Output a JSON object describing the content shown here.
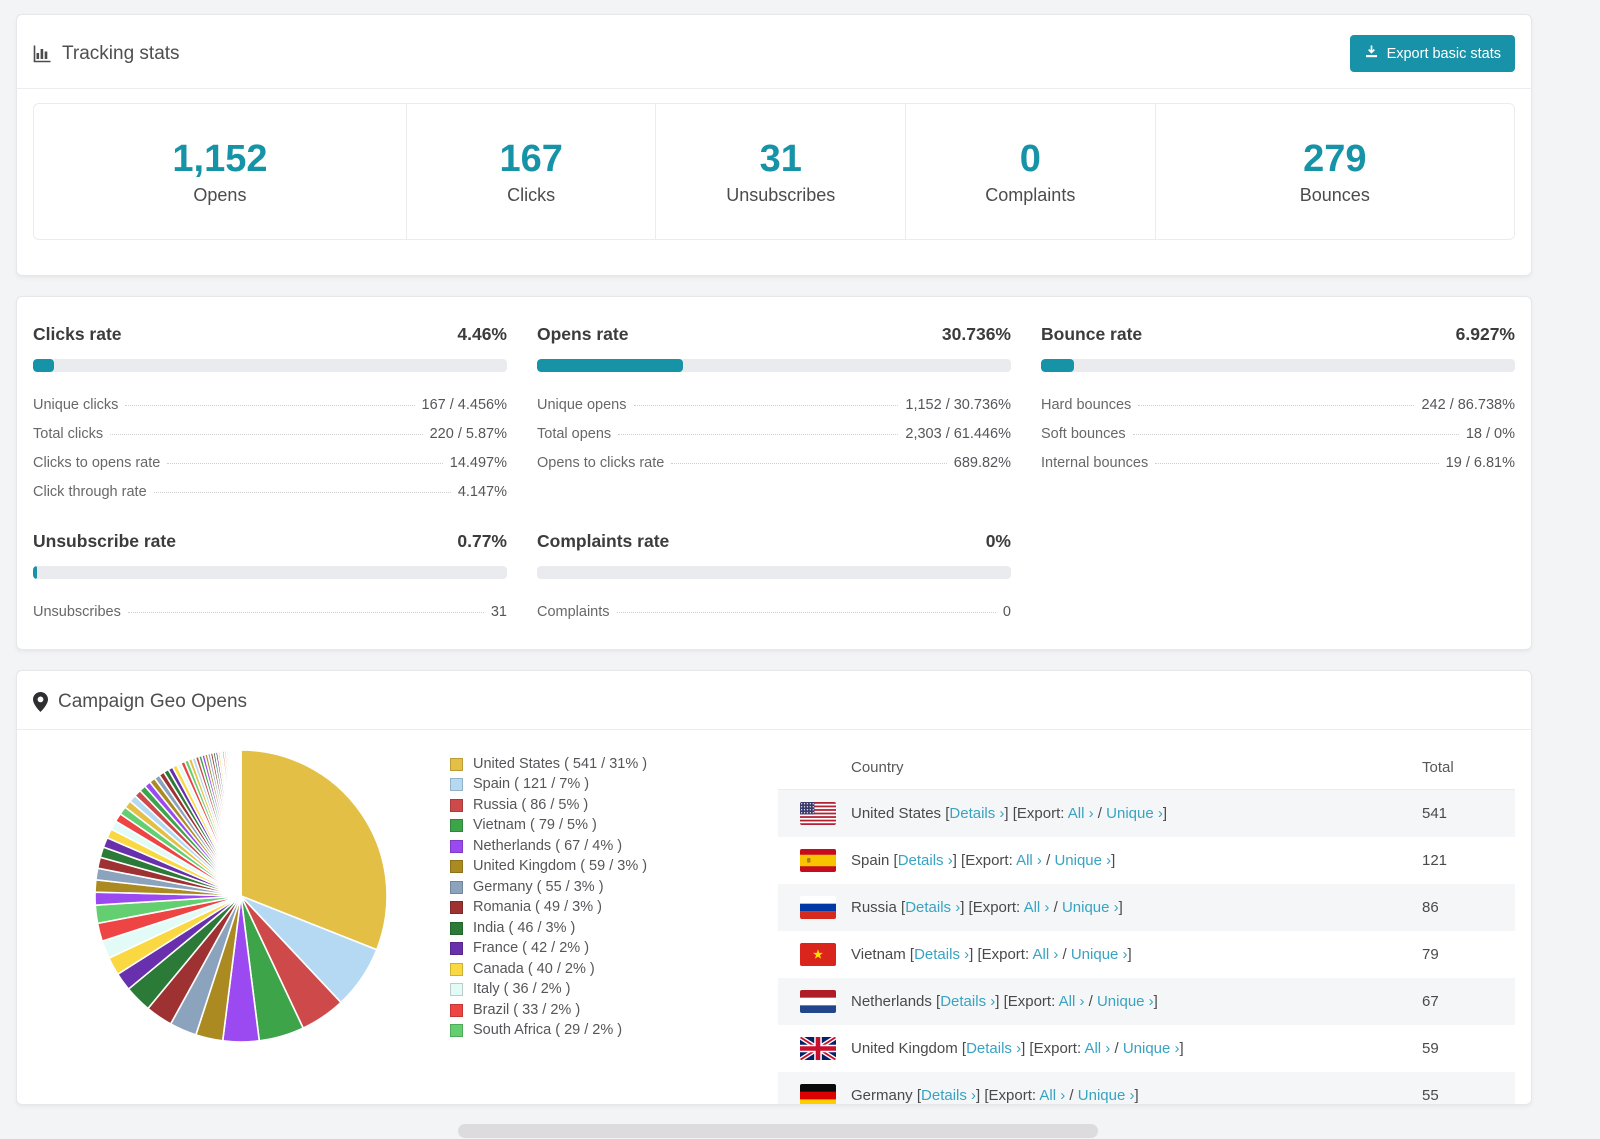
{
  "accent_color": "#1793a8",
  "link_color": "#38a3c2",
  "header": {
    "title": "Tracking stats",
    "title_icon": "bar-chart-icon",
    "export_button": "Export basic stats"
  },
  "summary": [
    {
      "value": "1,152",
      "label": "Opens"
    },
    {
      "value": "167",
      "label": "Clicks"
    },
    {
      "value": "31",
      "label": "Unsubscribes"
    },
    {
      "value": "0",
      "label": "Complaints"
    },
    {
      "value": "279",
      "label": "Bounces"
    }
  ],
  "rates": [
    {
      "name": "Clicks rate",
      "pct_label": "4.46%",
      "pct": 4.46,
      "rows": [
        {
          "label": "Unique clicks",
          "value": "167 / 4.456%"
        },
        {
          "label": "Total clicks",
          "value": "220 / 5.87%"
        },
        {
          "label": "Clicks to opens rate",
          "value": "14.497%"
        },
        {
          "label": "Click through rate",
          "value": "4.147%"
        }
      ]
    },
    {
      "name": "Opens rate",
      "pct_label": "30.736%",
      "pct": 30.736,
      "rows": [
        {
          "label": "Unique opens",
          "value": "1,152 / 30.736%"
        },
        {
          "label": "Total opens",
          "value": "2,303 / 61.446%"
        },
        {
          "label": "Opens to clicks rate",
          "value": "689.82%"
        }
      ]
    },
    {
      "name": "Bounce rate",
      "pct_label": "6.927%",
      "pct": 6.927,
      "rows": [
        {
          "label": "Hard bounces",
          "value": "242 / 86.738%"
        },
        {
          "label": "Soft bounces",
          "value": "18 / 0%"
        },
        {
          "label": "Internal bounces",
          "value": "19 / 6.81%"
        }
      ]
    },
    {
      "name": "Unsubscribe rate",
      "pct_label": "0.77%",
      "pct": 0.77,
      "rows": [
        {
          "label": "Unsubscribes",
          "value": "31"
        }
      ]
    },
    {
      "name": "Complaints rate",
      "pct_label": "0%",
      "pct": 0,
      "rows": [
        {
          "label": "Complaints",
          "value": "0"
        }
      ]
    }
  ],
  "geo": {
    "title": "Campaign Geo Opens",
    "title_icon": "map-pin-icon",
    "chart_data": {
      "type": "pie",
      "title": "Campaign Geo Opens",
      "legend_position": "right",
      "series": [
        {
          "name": "United States",
          "value": 541,
          "pct": 31,
          "color": "#e3bf45",
          "legend_label": "United States ( 541 / 31% )"
        },
        {
          "name": "Spain",
          "value": 121,
          "pct": 7,
          "color": "#b5d9f2",
          "legend_label": "Spain ( 121 / 7% )"
        },
        {
          "name": "Russia",
          "value": 86,
          "pct": 5,
          "color": "#ce4a4a",
          "legend_label": "Russia ( 86 / 5% )"
        },
        {
          "name": "Vietnam",
          "value": 79,
          "pct": 5,
          "color": "#3da44a",
          "legend_label": "Vietnam ( 79 / 5% )"
        },
        {
          "name": "Netherlands",
          "value": 67,
          "pct": 4,
          "color": "#9a4af0",
          "legend_label": "Netherlands ( 67 / 4% )"
        },
        {
          "name": "United Kingdom",
          "value": 59,
          "pct": 3,
          "color": "#ab8b21",
          "legend_label": "United Kingdom ( 59 / 3% )"
        },
        {
          "name": "Germany",
          "value": 55,
          "pct": 3,
          "color": "#8ba3bd",
          "legend_label": "Germany ( 55 / 3% )"
        },
        {
          "name": "Romania",
          "value": 49,
          "pct": 3,
          "color": "#9e3232",
          "legend_label": "Romania ( 49 / 3% )"
        },
        {
          "name": "India",
          "value": 46,
          "pct": 3,
          "color": "#2c7a38",
          "legend_label": "India ( 46 / 3% )"
        },
        {
          "name": "France",
          "value": 42,
          "pct": 2,
          "color": "#6930ad",
          "legend_label": "France ( 42 / 2% )"
        },
        {
          "name": "Canada",
          "value": 40,
          "pct": 2,
          "color": "#f9d842",
          "legend_label": "Canada ( 40 / 2% )"
        },
        {
          "name": "Italy",
          "value": 36,
          "pct": 2,
          "color": "#e3fbf7",
          "legend_label": "Italy ( 36 / 2% )"
        },
        {
          "name": "Brazil",
          "value": 33,
          "pct": 2,
          "color": "#ee4444",
          "legend_label": "Brazil ( 33 / 2% )"
        },
        {
          "name": "South Africa",
          "value": 29,
          "pct": 2,
          "color": "#63cf70",
          "legend_label": "South Africa ( 29 / 2% )"
        }
      ],
      "others": {
        "pct": 26,
        "slice_count": 48,
        "shrink_ratio": 0.95,
        "palette_offset": 4
      }
    },
    "table": {
      "headers": [
        "Country",
        "Total"
      ],
      "link_labels": {
        "details": "Details",
        "export_prefix": "Export:",
        "all": "All",
        "unique": "Unique",
        "chevron": "›"
      },
      "rows": [
        {
          "country": "United States",
          "flag": "us",
          "total": "541"
        },
        {
          "country": "Spain",
          "flag": "es",
          "total": "121"
        },
        {
          "country": "Russia",
          "flag": "ru",
          "total": "86"
        },
        {
          "country": "Vietnam",
          "flag": "vn",
          "total": "79"
        },
        {
          "country": "Netherlands",
          "flag": "nl",
          "total": "67"
        },
        {
          "country": "United Kingdom",
          "flag": "gb",
          "total": "59"
        },
        {
          "country": "Germany",
          "flag": "de",
          "total": "55"
        }
      ]
    }
  }
}
